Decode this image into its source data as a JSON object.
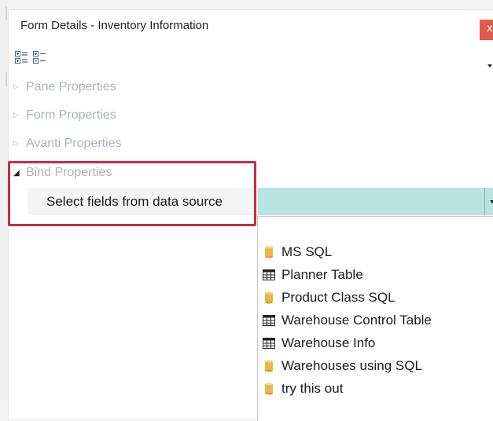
{
  "window": {
    "title": "Form Details - Inventory Information",
    "close_label": "x"
  },
  "toolbar": {
    "buttons": [
      {
        "icon": "categorized-view-icon"
      },
      {
        "icon": "alphabetical-view-icon"
      }
    ]
  },
  "categories": [
    {
      "label": "Pane Properties",
      "expanded": false
    },
    {
      "label": "Form Properties",
      "expanded": false
    },
    {
      "label": "Avanti Properties",
      "expanded": false
    },
    {
      "label": "Bind Properties",
      "expanded": true
    }
  ],
  "bind_property": {
    "label": "Select fields from data source",
    "value": ""
  },
  "data_sources": [
    {
      "label": "MS SQL",
      "icon": "database-icon"
    },
    {
      "label": "Planner Table",
      "icon": "table-icon"
    },
    {
      "label": "Product Class SQL",
      "icon": "database-icon"
    },
    {
      "label": "Warehouse Control Table",
      "icon": "table-icon"
    },
    {
      "label": "Warehouse Info",
      "icon": "table-icon"
    },
    {
      "label": "Warehouses using SQL",
      "icon": "database-icon"
    },
    {
      "label": "try this out",
      "icon": "database-icon"
    }
  ],
  "colors": {
    "highlight": "#cb2a44",
    "value_bg": "#b9e3e1",
    "close_bg": "#e05a4e",
    "database_icon": "#e8b84a"
  }
}
